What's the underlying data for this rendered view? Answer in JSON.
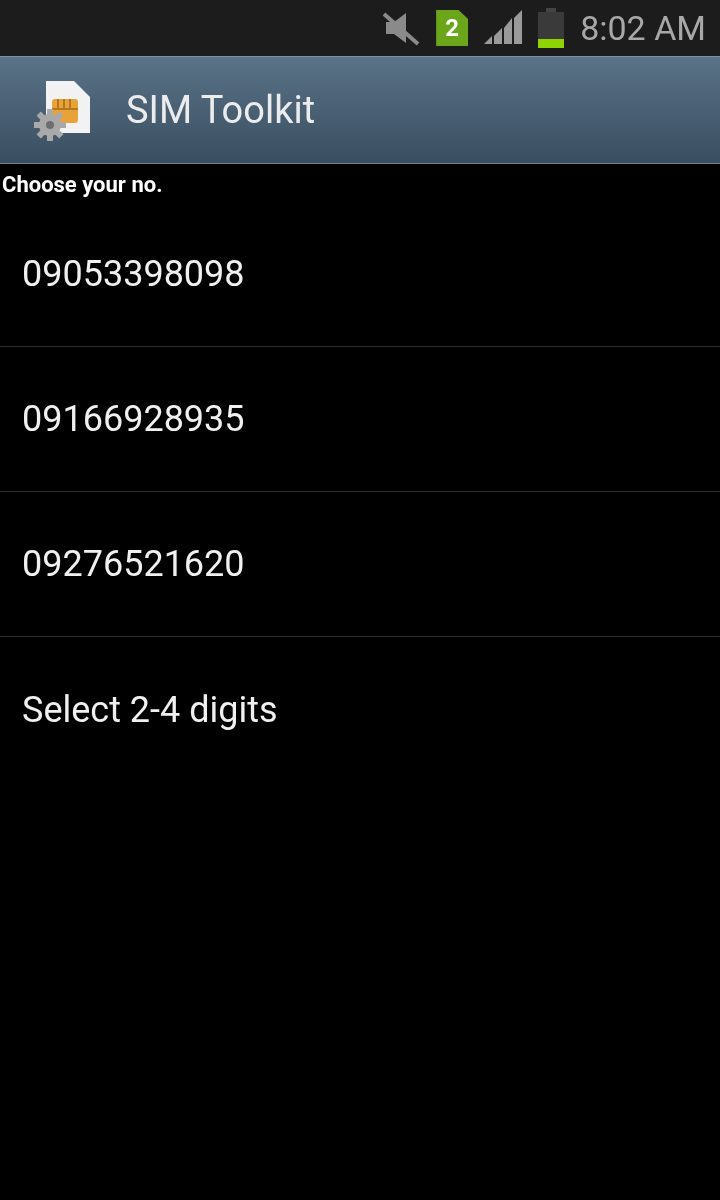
{
  "status_bar": {
    "sim_badge": "2",
    "time": "8:02 AM"
  },
  "header": {
    "title": "SIM Toolkit"
  },
  "prompt": "Choose your no.",
  "items": [
    {
      "label": "09053398098"
    },
    {
      "label": "09166928935"
    },
    {
      "label": "09276521620"
    },
    {
      "label": "Select 2-4 digits"
    }
  ]
}
